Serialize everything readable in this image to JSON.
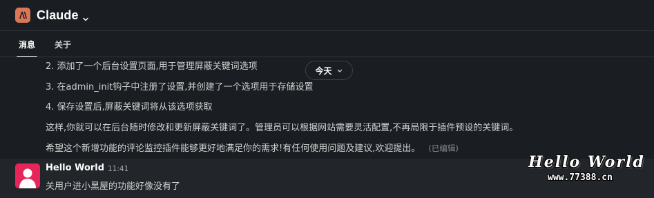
{
  "header": {
    "app_name": "Claude",
    "icon": "claude-logo-icon",
    "accent_color": "#d97757"
  },
  "tabs": [
    {
      "label": "消息",
      "active": true
    },
    {
      "label": "关于",
      "active": false
    }
  ],
  "messages": {
    "lines": [
      "2. 添加了一个后台设置页面,用于管理屏蔽关键词选项",
      "3. 在admin_init钩子中注册了设置,并创建了一个选项用于存储设置",
      "4. 保存设置后,屏蔽关键词将从该选项获取",
      "这样,你就可以在后台随时修改和更新屏蔽关键词了。管理员可以根据网站需要灵活配置,不再局限于插件预设的关键词。",
      "希望这个新增功能的评论监控插件能够更好地满足你的需求!有任何使用问题及建议,欢迎提出。"
    ],
    "edited_label": "(已编辑)",
    "date_divider": "今天",
    "highlighted": {
      "author": "Hello World",
      "time": "11:41",
      "text": "关用户进小黑屋的功能好像没有了",
      "avatar_color": "#e8255b"
    }
  },
  "watermark": {
    "title": "Hello World",
    "url": "www.77388.cn"
  }
}
